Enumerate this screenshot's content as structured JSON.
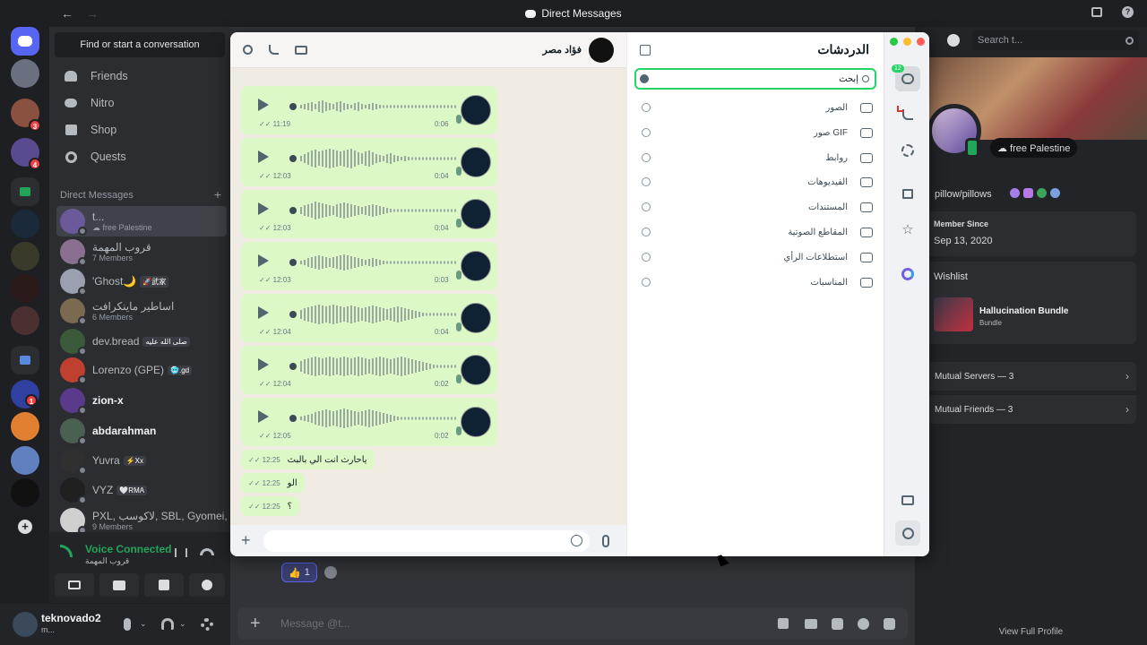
{
  "window": {
    "title": "Direct Messages"
  },
  "sidebar": {
    "find_placeholder": "Find or start a conversation",
    "nav": [
      {
        "label": "Friends",
        "icon": "friends-icon"
      },
      {
        "label": "Nitro",
        "icon": "nitro-icon"
      },
      {
        "label": "Shop",
        "icon": "shop-icon"
      },
      {
        "label": "Quests",
        "icon": "quests-icon"
      }
    ],
    "dm_header": "Direct Messages",
    "dms": [
      {
        "name": "t...",
        "sub": "☁ free Palestine",
        "color": "#6a5a9a"
      },
      {
        "name": "قروب المهمة",
        "sub": "7 Members",
        "color": "#8a7090"
      },
      {
        "name": "'Ghost🌙",
        "tag": "🚀武家",
        "sub": "",
        "color": "#9aa0b0"
      },
      {
        "name": "اساطير ماينكرافت",
        "sub": "6 Members",
        "color": "#7a6a50"
      },
      {
        "name": "dev.bread",
        "tag": "صلى الله عليه",
        "sub": "",
        "color": "#3a5a3a"
      },
      {
        "name": "Lorenzo (GPE)",
        "tag": "🥶.gd",
        "sub": "",
        "color": "#c04030"
      },
      {
        "name": "zion-x",
        "sub": "",
        "color": "#5a3a8a"
      },
      {
        "name": "abdarahman",
        "sub": "",
        "color": "#4a6050"
      },
      {
        "name": "Yuvra",
        "tag": "⚡Xx",
        "sub": "",
        "color": "#303030"
      },
      {
        "name": "VYZ",
        "tag": "🤍RMA",
        "sub": "",
        "color": "#202020"
      },
      {
        "name": "PXL, لاكوسب, SBL, Gyomei, ...",
        "sub": "9 Members",
        "color": "#d0d0d0"
      }
    ],
    "voice": {
      "status": "Voice Connected",
      "channel": "قروب المهمة"
    },
    "user": {
      "name": "teknovado2",
      "status": "m..."
    }
  },
  "servers": [
    {
      "badge": ""
    },
    {
      "badge": "3"
    },
    {
      "badge": "4"
    },
    {
      "badge": ""
    },
    {
      "badge": ""
    },
    {
      "badge": ""
    },
    {
      "badge": ""
    },
    {
      "badge": ""
    },
    {
      "badge": "1"
    },
    {
      "badge": ""
    },
    {
      "badge": ""
    },
    {
      "badge": ""
    }
  ],
  "whatsapp": {
    "chat_title": "فؤاد مصر",
    "list_title": "الدردشات",
    "search_placeholder": "إبحث",
    "unread": "12",
    "filters": [
      {
        "label": "الصور",
        "icon": "camera-icon"
      },
      {
        "label": "صور GIF",
        "icon": "gif-icon"
      },
      {
        "label": "روابط",
        "icon": "link-icon"
      },
      {
        "label": "الفيديوهات",
        "icon": "video-icon"
      },
      {
        "label": "المستندات",
        "icon": "document-icon"
      },
      {
        "label": "المقاطع الصوتية",
        "icon": "audio-icon"
      },
      {
        "label": "استطلاعات الرأي",
        "icon": "poll-icon"
      },
      {
        "label": "المناسبات",
        "icon": "calendar-icon"
      }
    ],
    "voice_notes": [
      {
        "time": "11:19",
        "duration": "0:06"
      },
      {
        "time": "12:03",
        "duration": "0:04"
      },
      {
        "time": "12:03",
        "duration": "0:04"
      },
      {
        "time": "12:03",
        "duration": "0:03"
      },
      {
        "time": "12:04",
        "duration": "0:04"
      },
      {
        "time": "12:04",
        "duration": "0:02"
      },
      {
        "time": "12:05",
        "duration": "0:02"
      }
    ],
    "texts": [
      {
        "time": "12:25",
        "text": "ياحارث انت الي بالبث"
      },
      {
        "time": "12:25",
        "text": "الو"
      },
      {
        "time": "12:25",
        "text": "؟"
      }
    ]
  },
  "main": {
    "reaction_count": "1",
    "message_placeholder": "Message @t..."
  },
  "profile": {
    "search_placeholder": "Search t...",
    "status": "☁ free Palestine",
    "handle": "pillow/pillows",
    "member_since_label": "Member Since",
    "member_since": "Sep 13, 2020",
    "wishlist_label": "Wishlist",
    "wish_item": "Hallucination Bundle",
    "wish_type": "Bundle",
    "mutual_servers": "Mutual Servers — 3",
    "mutual_friends": "Mutual Friends — 3",
    "view_full": "View Full Profile"
  },
  "colors": {
    "accent": "#5865f2",
    "whatsapp_green": "#25d366",
    "bubble": "#dcf8c6",
    "voice_green": "#23a559"
  }
}
